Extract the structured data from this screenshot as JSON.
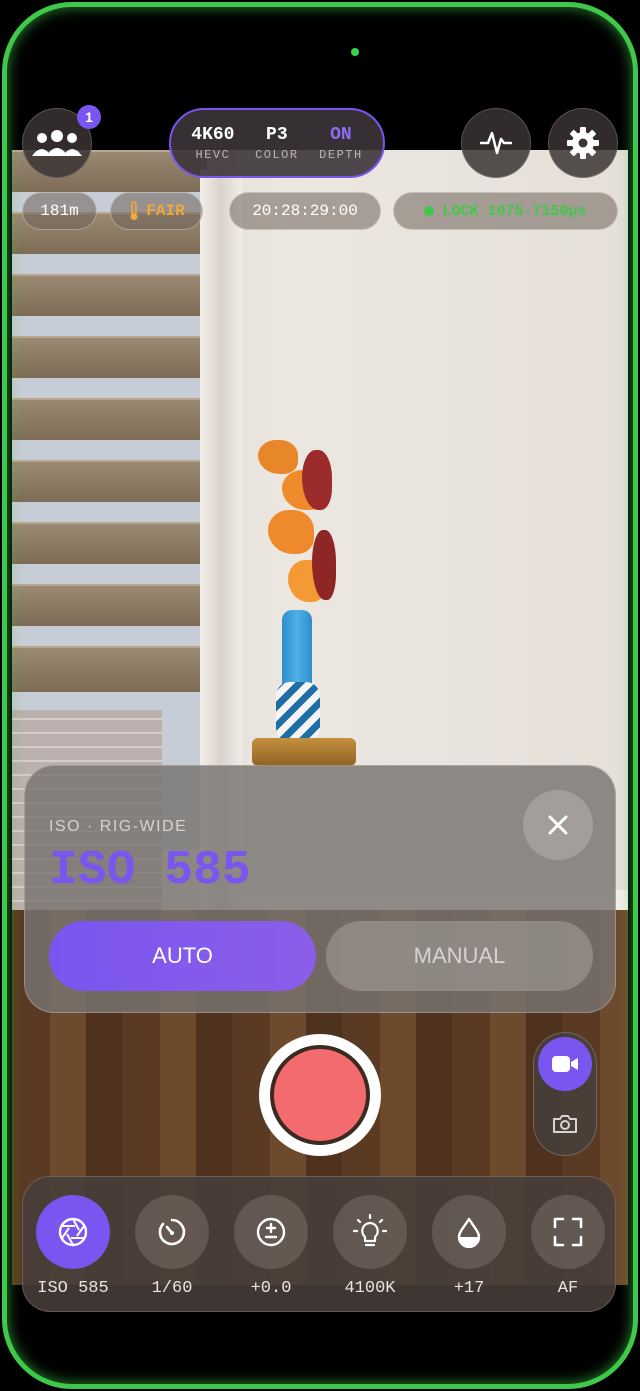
{
  "top": {
    "group_badge": "1",
    "format": [
      {
        "value": "4K60",
        "key": "HEVC",
        "active": false
      },
      {
        "value": "P3",
        "key": "COLOR",
        "active": false
      },
      {
        "value": "ON",
        "key": "DEPTH",
        "active": true
      }
    ]
  },
  "chips": {
    "distance": "181m",
    "thermal": "FAIR",
    "timecode": "20:28:29:00",
    "lock": "LOCK 1075·7150µs"
  },
  "iso_panel": {
    "subtitle": "ISO · RIG-WIDE",
    "value": "ISO 585",
    "auto_label": "AUTO",
    "manual_label": "MANUAL",
    "selected": "AUTO"
  },
  "capture_mode": "video",
  "toolbar": [
    {
      "label": "ISO 585",
      "icon": "aperture-icon",
      "active": true
    },
    {
      "label": "1/60",
      "icon": "shutter-timer-icon",
      "active": false
    },
    {
      "label": "+0.0",
      "icon": "exposure-icon",
      "active": false
    },
    {
      "label": "4100K",
      "icon": "bulb-icon",
      "active": false
    },
    {
      "label": "+17",
      "icon": "tint-drop-icon",
      "active": false
    },
    {
      "label": "AF",
      "icon": "focus-frame-icon",
      "active": false
    }
  ],
  "colors": {
    "accent": "#7b55f0",
    "record": "#f36b6e",
    "lock_green": "#3ec94a",
    "fair_orange": "#f2a83a"
  }
}
